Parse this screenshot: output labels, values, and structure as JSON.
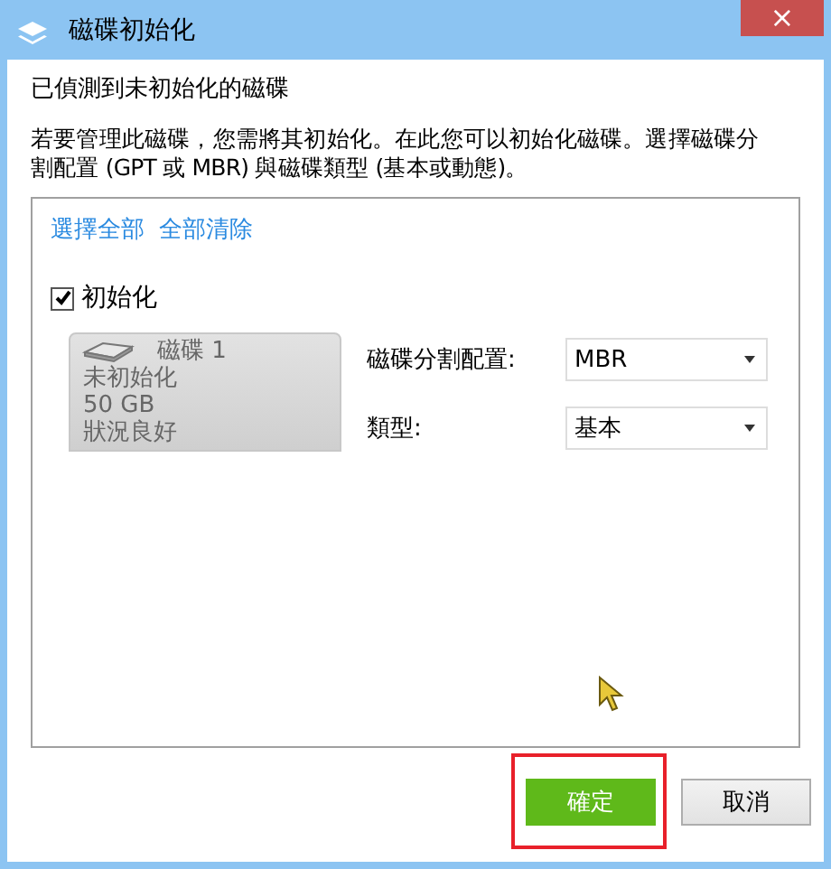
{
  "window": {
    "title": "磁碟初始化",
    "close": "×"
  },
  "heading": "已偵測到未初始化的磁碟",
  "description": "若要管理此磁碟，您需將其初始化。在此您可以初始化磁碟。選擇磁碟分割配置 (GPT 或 MBR) 與磁碟類型 (基本或動態)。",
  "links": [
    "選擇全部",
    "全部清除"
  ],
  "disks": [
    {
      "checkbox": {
        "label": "初始化",
        "checked": true
      },
      "name": "磁碟 1",
      "lines": [
        "未初始化",
        "50 GB",
        "狀況良好"
      ],
      "settings": [
        {
          "label": "磁碟分割配置:",
          "value": "MBR"
        },
        {
          "label": "類型:",
          "value": "基本"
        }
      ]
    }
  ],
  "buttons": [
    {
      "label": "確定",
      "kind": "primary",
      "highlighted": true
    },
    {
      "label": "取消",
      "kind": "secondary",
      "highlighted": false
    }
  ]
}
